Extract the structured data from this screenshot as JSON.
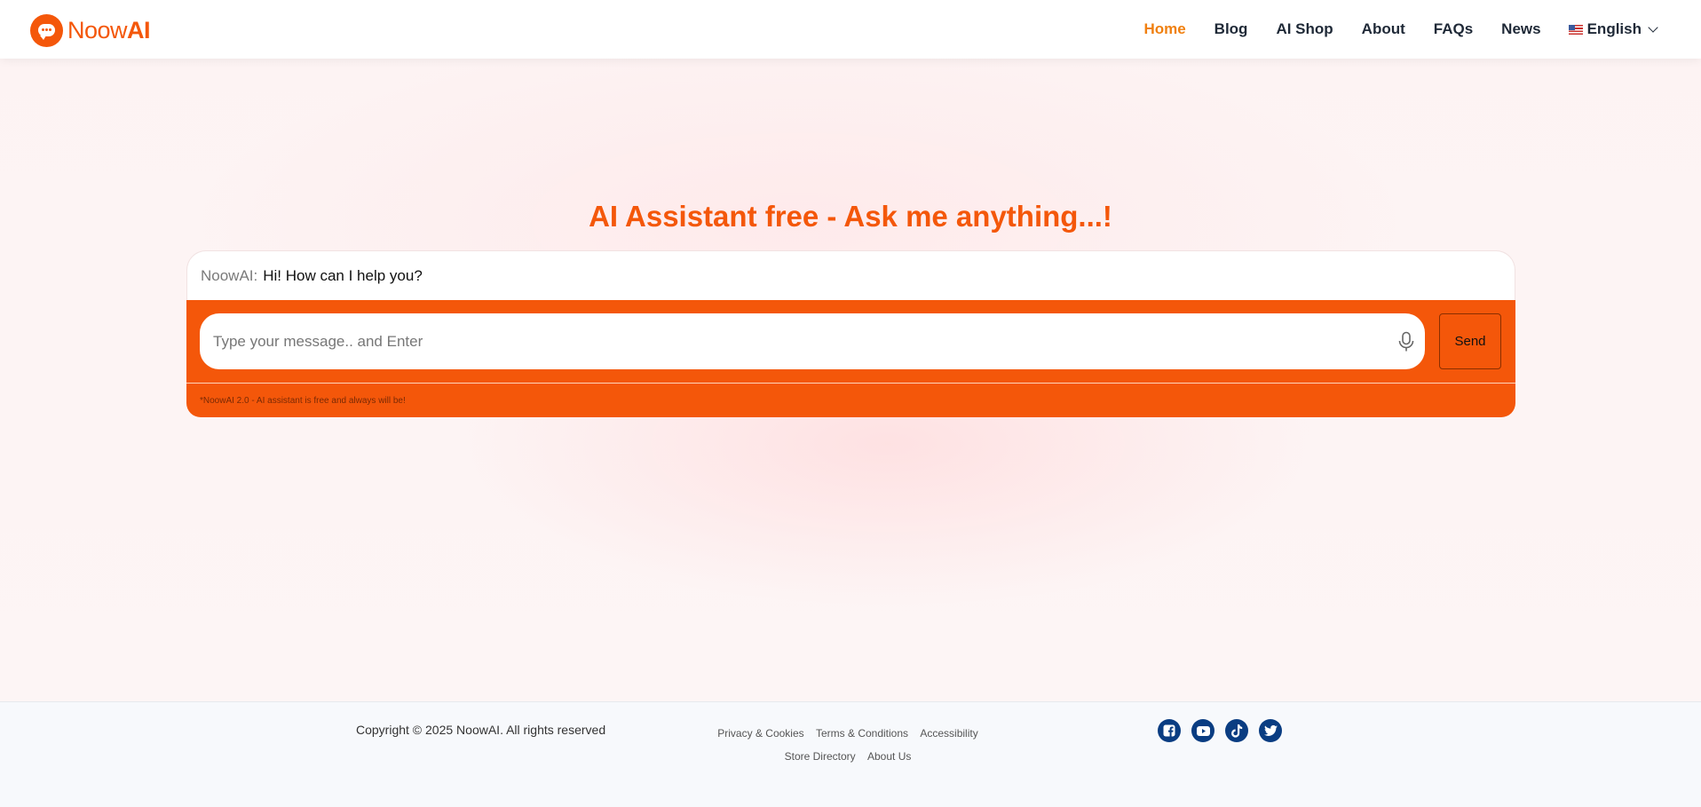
{
  "brand": {
    "name_light": "Noow",
    "name_bold": "AI"
  },
  "nav": {
    "items": [
      {
        "label": "Home",
        "active": true
      },
      {
        "label": "Blog"
      },
      {
        "label": "AI Shop"
      },
      {
        "label": "About"
      },
      {
        "label": "FAQs"
      },
      {
        "label": "News"
      }
    ],
    "language": "English"
  },
  "hero": {
    "title": "AI Assistant free - Ask me anything...!"
  },
  "chat": {
    "bot_label": "NoowAI:",
    "bot_message": "Hi! How can I help you?",
    "input_placeholder": "Type your message.. and Enter",
    "send_label": "Send",
    "note": "*NoowAI 2.0 - AI assistant is free and always will be!"
  },
  "footer": {
    "copyright": "Copyright © 2025 NoowAI. All rights reserved",
    "links_row1": [
      "Privacy & Cookies",
      "Terms & Conditions",
      "Accessibility"
    ],
    "links_row2": [
      "Store Directory",
      "About Us"
    ],
    "social": [
      "facebook-icon",
      "youtube-icon",
      "tiktok-icon",
      "twitter-icon"
    ]
  },
  "colors": {
    "accent": "#f4570a",
    "nav_active": "#f08010",
    "social": "#0a3d82"
  }
}
